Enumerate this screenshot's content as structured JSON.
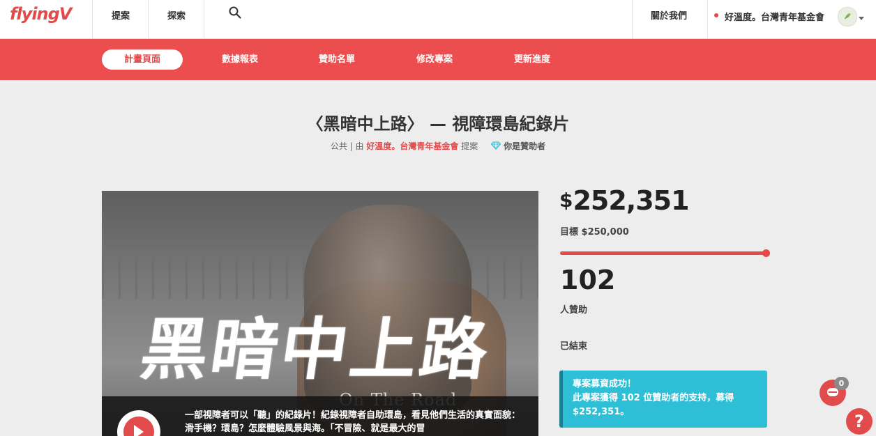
{
  "header": {
    "logo": "flyingV",
    "nav": [
      "提案",
      "探索"
    ],
    "about": "關於我們",
    "user_name": "好溫度。台灣青年基金會",
    "icons": {
      "search": "search-icon",
      "avatar": "avatar",
      "dropdown": "caret-down-icon"
    }
  },
  "subnav": {
    "tabs": [
      "計畫頁面",
      "數據報表",
      "贊助名單",
      "修改專案",
      "更新進度"
    ],
    "active_index": 0
  },
  "project": {
    "title": "〈黑暗中上路〉 — 視障環島紀錄片",
    "visibility": "公共",
    "sep": "|",
    "by": "由",
    "owner": "好溫度。台灣青年基金會",
    "proposed": "提案",
    "sponsor_tag": "你是贊助者"
  },
  "video": {
    "title_art": "黑暗中上路",
    "subtitle_art": "On The Road",
    "description": "一部視障者可以「聽」的紀錄片！紀錄視障者自助環島，看見他們生活的真實面貌：滑手機？環島？怎麼體驗風景與海。「不冒險、就是最大的冒"
  },
  "stats": {
    "currency": "$",
    "amount": "252,351",
    "goal_label": "目標 $250,000",
    "progress": 1.0,
    "backers": "102",
    "backers_label": "人贊助",
    "status": "已結束",
    "success_line1": "專案募資成功！",
    "success_line2": "此專案獲得 102 位贊助者的支持，募得",
    "success_line3": "$252,351。"
  },
  "widgets": {
    "chat_count": "0",
    "help": "?"
  },
  "colors": {
    "brand": "#e14b4b",
    "subnav_bg": "#ec4d4e",
    "success_bg": "#2ebfd6"
  }
}
